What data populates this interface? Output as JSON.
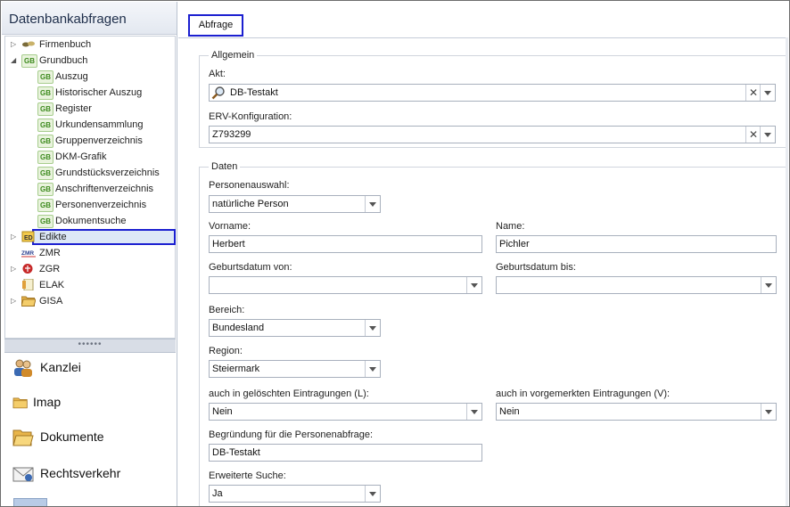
{
  "sidebar": {
    "title": "Datenbankabfragen",
    "tree": [
      {
        "label": "Firmenbuch",
        "expander": "▷",
        "icon": "firmenbuch-icon",
        "indent": 0
      },
      {
        "label": "Grundbuch",
        "expander": "◢",
        "icon": "GB",
        "indent": 0
      },
      {
        "label": "Auszug",
        "icon": "GB",
        "indent": 1
      },
      {
        "label": "Historischer Auszug",
        "icon": "GB",
        "indent": 1
      },
      {
        "label": "Register",
        "icon": "GB",
        "indent": 1
      },
      {
        "label": "Urkundensammlung",
        "icon": "GB",
        "indent": 1
      },
      {
        "label": "Gruppenverzeichnis",
        "icon": "GB",
        "indent": 1
      },
      {
        "label": "DKM-Grafik",
        "icon": "GB",
        "indent": 1
      },
      {
        "label": "Grundstücksverzeichnis",
        "icon": "GB",
        "indent": 1
      },
      {
        "label": "Anschriftenverzeichnis",
        "icon": "GB",
        "indent": 1
      },
      {
        "label": "Personenverzeichnis",
        "icon": "GB",
        "indent": 1,
        "selected": true
      },
      {
        "label": "Dokumentsuche",
        "icon": "GB",
        "indent": 1
      },
      {
        "label": "Edikte",
        "expander": "▷",
        "icon": "edikte-icon",
        "indent": 0
      },
      {
        "label": "ZMR",
        "icon": "zmr-icon",
        "indent": 0
      },
      {
        "label": "ZGR",
        "expander": "▷",
        "icon": "zgr-icon",
        "indent": 0
      },
      {
        "label": "ELAK",
        "icon": "elak-icon",
        "indent": 0
      },
      {
        "label": "GISA",
        "expander": "▷",
        "icon": "folder-icon",
        "indent": 0
      }
    ],
    "splitter_grip": "••••••",
    "nav": [
      {
        "label": "Kanzlei",
        "icon": "users-icon"
      },
      {
        "label": "Imap",
        "icon": "folder-icon"
      },
      {
        "label": "Dokumente",
        "icon": "folder-open-icon"
      },
      {
        "label": "Rechtsverkehr",
        "icon": "envelope-icon"
      }
    ]
  },
  "main": {
    "tab": "Abfrage",
    "allgemein": {
      "legend": "Allgemein",
      "akt_label": "Akt:",
      "akt_value": "DB-Testakt",
      "erv_label": "ERV-Konfiguration:",
      "erv_value": "Z793299",
      "clear_glyph": "✕"
    },
    "daten": {
      "legend": "Daten",
      "personenauswahl_label": "Personenauswahl:",
      "personenauswahl_value": "natürliche Person",
      "vorname_label": "Vorname:",
      "vorname_value": "Herbert",
      "name_label": "Name:",
      "name_value": "Pichler",
      "geb_von_label": "Geburtsdatum von:",
      "geb_von_value": "",
      "geb_bis_label": "Geburtsdatum bis:",
      "geb_bis_value": "",
      "bereich_label": "Bereich:",
      "bereich_value": "Bundesland",
      "region_label": "Region:",
      "region_value": "Steiermark",
      "geloescht_label": "auch in gelöschten Eintragungen (L):",
      "geloescht_value": "Nein",
      "vorgemerkt_label": "auch in vorgemerkten Eintragungen (V):",
      "vorgemerkt_value": "Nein",
      "begruendung_label": "Begründung für die Personenabfrage:",
      "begruendung_value": "DB-Testakt",
      "erweitert_label": "Erweiterte Suche:",
      "erweitert_value": "Ja"
    }
  },
  "colors": {
    "selection_border": "#1b1fd0",
    "gb_green": "#3c8a1d"
  }
}
